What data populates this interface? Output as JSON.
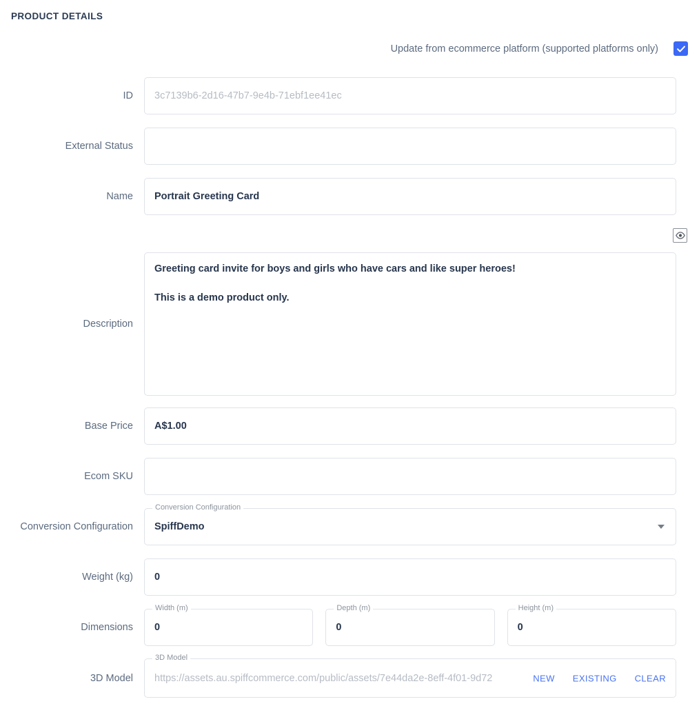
{
  "section": {
    "title": "PRODUCT DETAILS"
  },
  "ecommerce_toggle": {
    "label": "Update from ecommerce platform (supported platforms only)",
    "checked": true,
    "accent_color": "#3b68f5"
  },
  "fields": {
    "id": {
      "label": "ID",
      "placeholder": "3c7139b6-2d16-47b7-9e4b-71ebf1ee41ec",
      "value": ""
    },
    "external_status": {
      "label": "External Status",
      "value": ""
    },
    "name": {
      "label": "Name",
      "value": "Portrait Greeting Card"
    },
    "description": {
      "label": "Description",
      "lines": [
        "Greeting card invite for boys and girls who have cars and like super heroes!",
        "This is a demo product only."
      ]
    },
    "base_price": {
      "label": "Base Price",
      "value": "A$1.00"
    },
    "ecom_sku": {
      "label": "Ecom SKU",
      "value": ""
    },
    "conversion_configuration": {
      "label": "Conversion Configuration",
      "notch_label": "Conversion Configuration",
      "value": "SpiffDemo"
    },
    "weight": {
      "label": "Weight (kg)",
      "value": "0"
    },
    "dimensions": {
      "label": "Dimensions",
      "width": {
        "notch_label": "Width (m)",
        "value": "0"
      },
      "depth": {
        "notch_label": "Depth (m)",
        "value": "0"
      },
      "height": {
        "notch_label": "Height (m)",
        "value": "0"
      }
    },
    "model_3d": {
      "label": "3D Model",
      "notch_label": "3D Model",
      "placeholder": "https://assets.au.spiffcommerce.com/public/assets/7e44da2e-8eff-4f01-9d72",
      "actions": {
        "new": "NEW",
        "existing": "EXISTING",
        "clear": "CLEAR"
      }
    }
  },
  "icons": {
    "preview_eye": "eye-icon",
    "dropdown": "chevron-down-icon",
    "checkmark": "check-icon"
  }
}
